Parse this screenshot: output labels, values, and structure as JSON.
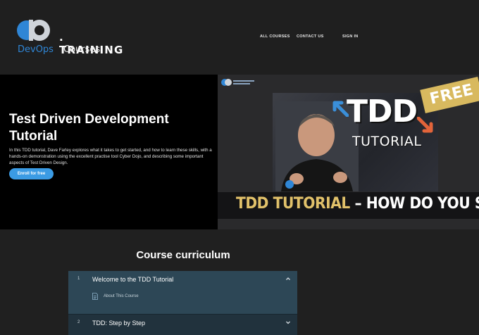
{
  "brand": {
    "training": ". TRAINING",
    "devops": "DevOps",
    "courses": "Courses"
  },
  "nav": {
    "all_courses": "ALL COURSES",
    "contact_us": "CONTACT US",
    "sign_in": "SIGN IN"
  },
  "hero": {
    "title": "Test Driven Development Tutorial",
    "description": "In this TDD tutorial, Dave Farley explores what it takes to get started, and how to learn these skills, with a hands-on demonstration using the excellent practise tool Cyber Dojo, and describing some important aspects of Test Driven Design.",
    "enroll_label": "Enroll for free"
  },
  "thumbnail": {
    "tdd": "TDD",
    "tutorial": "TUTORIAL",
    "free": "FREE",
    "banner_accent": "TDD TUTORIAL",
    "banner_rest": " – HOW DO YOU START"
  },
  "curriculum": {
    "title": "Course curriculum",
    "sections": [
      {
        "number": "1",
        "title": "Welcome to the TDD Tutorial",
        "expanded": true,
        "lessons": [
          {
            "label": "About This Course",
            "icon": "document-icon"
          }
        ]
      },
      {
        "number": "2",
        "title": "TDD: Step by Step",
        "expanded": false,
        "lessons": []
      }
    ]
  },
  "colors": {
    "accent": "#3b9be4",
    "brand_blue": "#2f86d6",
    "section_active": "#2d4756",
    "section_idle": "#21323d",
    "badge_gold": "#d8b95f"
  }
}
